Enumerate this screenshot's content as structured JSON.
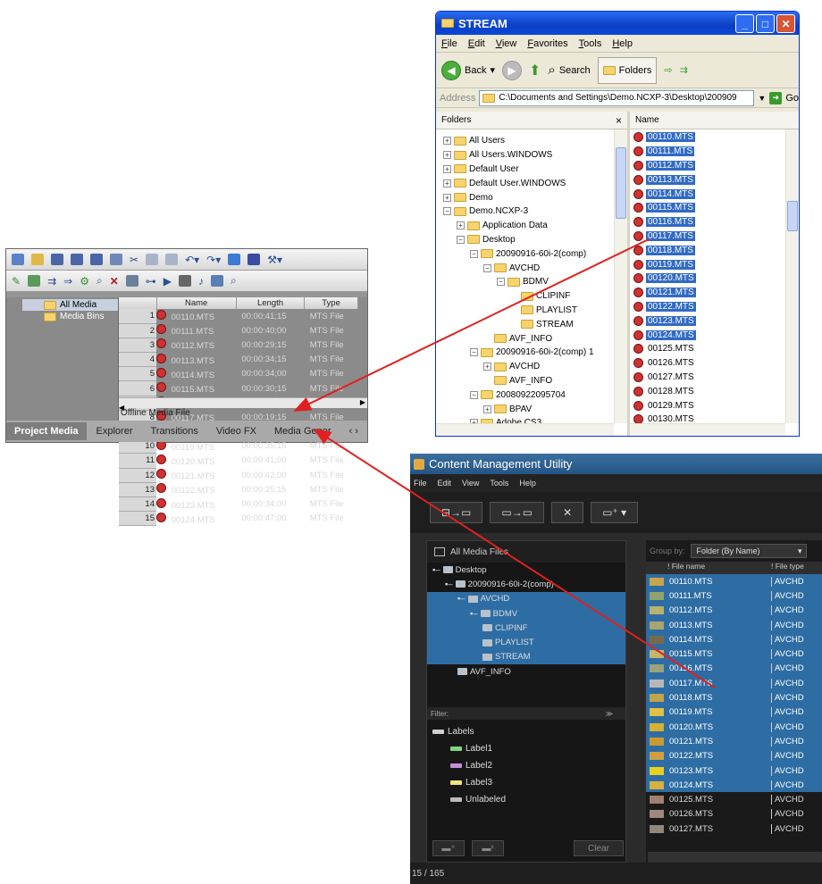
{
  "explorer": {
    "title": "STREAM",
    "menu": [
      "File",
      "Edit",
      "View",
      "Favorites",
      "Tools",
      "Help"
    ],
    "toolbar": {
      "back": "Back",
      "search": "Search",
      "folders": "Folders"
    },
    "address_label": "Address",
    "address_value": "C:\\Documents and Settings\\Demo.NCXP-3\\Desktop\\200909",
    "go": "Go",
    "folders_header": "Folders",
    "close_x": "×",
    "name_header": "Name",
    "tree": [
      {
        "label": "All Users",
        "indent": 0,
        "pm": "+"
      },
      {
        "label": "All Users.WINDOWS",
        "indent": 0,
        "pm": "+"
      },
      {
        "label": "Default User",
        "indent": 0,
        "pm": "+"
      },
      {
        "label": "Default User.WINDOWS",
        "indent": 0,
        "pm": "+"
      },
      {
        "label": "Demo",
        "indent": 0,
        "pm": "+"
      },
      {
        "label": "Demo.NCXP-3",
        "indent": 0,
        "pm": "-"
      },
      {
        "label": "Application Data",
        "indent": 1,
        "pm": "+"
      },
      {
        "label": "Desktop",
        "indent": 1,
        "pm": "-"
      },
      {
        "label": "20090916-60i-2(comp)",
        "indent": 2,
        "pm": "-"
      },
      {
        "label": "AVCHD",
        "indent": 3,
        "pm": "-"
      },
      {
        "label": "BDMV",
        "indent": 4,
        "pm": "-"
      },
      {
        "label": "CLIPINF",
        "indent": 5,
        "pm": ""
      },
      {
        "label": "PLAYLIST",
        "indent": 5,
        "pm": ""
      },
      {
        "label": "STREAM",
        "indent": 5,
        "pm": "",
        "sel": true
      },
      {
        "label": "AVF_INFO",
        "indent": 3,
        "pm": ""
      },
      {
        "label": "20090916-60i-2(comp) 1",
        "indent": 2,
        "pm": "-"
      },
      {
        "label": "AVCHD",
        "indent": 3,
        "pm": "+"
      },
      {
        "label": "AVF_INFO",
        "indent": 3,
        "pm": ""
      },
      {
        "label": "20080922095704",
        "indent": 2,
        "pm": "-"
      },
      {
        "label": "BPAV",
        "indent": 3,
        "pm": "+"
      },
      {
        "label": "Adobe CS3",
        "indent": 2,
        "pm": "+"
      }
    ],
    "files": [
      "00110.MTS",
      "00111.MTS",
      "00112.MTS",
      "00113.MTS",
      "00114.MTS",
      "00115.MTS",
      "00116.MTS",
      "00117.MTS",
      "00118.MTS",
      "00119.MTS",
      "00120.MTS",
      "00121.MTS",
      "00122.MTS",
      "00123.MTS",
      "00124.MTS",
      "00125.MTS",
      "00126.MTS",
      "00127.MTS",
      "00128.MTS",
      "00129.MTS",
      "00130.MTS"
    ],
    "selected_count": 15
  },
  "vegas": {
    "tree": [
      "All Media",
      "Media Bins"
    ],
    "columns": [
      "Name",
      "Length",
      "Type"
    ],
    "rows": [
      [
        "1",
        "00110.MTS",
        "00:00:41;15",
        "MTS File"
      ],
      [
        "2",
        "00111.MTS",
        "00:00:40;00",
        "MTS File"
      ],
      [
        "3",
        "00112.MTS",
        "00:00:29;15",
        "MTS File"
      ],
      [
        "4",
        "00113.MTS",
        "00:00:34;15",
        "MTS File"
      ],
      [
        "5",
        "00114.MTS",
        "00:00:34;00",
        "MTS File"
      ],
      [
        "6",
        "00115.MTS",
        "00:00:30;15",
        "MTS File"
      ],
      [
        "7",
        "00116.MTS",
        "00:00:22;15",
        "MTS File"
      ],
      [
        "8",
        "00117.MTS",
        "00:00:19;15",
        "MTS File"
      ],
      [
        "9",
        "00118.MTS",
        "00:00:31;00",
        "MTS File"
      ],
      [
        "10",
        "00119.MTS",
        "00:00:35;15",
        "MTS File"
      ],
      [
        "11",
        "00120.MTS",
        "00:00:41;00",
        "MTS File"
      ],
      [
        "12",
        "00121.MTS",
        "00:00:42;00",
        "MTS File"
      ],
      [
        "13",
        "00122.MTS",
        "00:00:25;15",
        "MTS File"
      ],
      [
        "14",
        "00123.MTS",
        "00:00:34;00",
        "MTS File"
      ],
      [
        "15",
        "00124.MTS",
        "00:00:47;00",
        "MTS File"
      ]
    ],
    "offline": "Offline Media File",
    "tabs": [
      "Project Media",
      "Explorer",
      "Transitions",
      "Video FX",
      "Media Gener"
    ]
  },
  "cmu": {
    "title": "Content Management Utility",
    "menu": [
      "File",
      "Edit",
      "View",
      "Tools",
      "Help"
    ],
    "all_media": "All Media Files",
    "tree": [
      {
        "label": "Desktop",
        "indent": 0,
        "pm": "-",
        "sel": false
      },
      {
        "label": "20090916-60i-2(comp)",
        "indent": 1,
        "pm": "-",
        "sel": false
      },
      {
        "label": "AVCHD",
        "indent": 2,
        "pm": "-",
        "sel": true
      },
      {
        "label": "BDMV",
        "indent": 3,
        "pm": "-",
        "sel": true
      },
      {
        "label": "CLIPINF",
        "indent": 4,
        "pm": "",
        "sel": true
      },
      {
        "label": "PLAYLIST",
        "indent": 4,
        "pm": "",
        "sel": true
      },
      {
        "label": "STREAM",
        "indent": 4,
        "pm": "",
        "sel": true
      },
      {
        "label": "AVF_INFO",
        "indent": 2,
        "pm": "",
        "sel": false
      }
    ],
    "filter": "Filter:",
    "labels": [
      {
        "label": "Labels",
        "color": "#cfcfcf"
      },
      {
        "label": "Label1",
        "color": "#7fd67f"
      },
      {
        "label": "Label2",
        "color": "#c38fd6"
      },
      {
        "label": "Label3",
        "color": "#f2e37a"
      },
      {
        "label": "Unlabeled",
        "color": "#bbbbbb"
      }
    ],
    "clear": "Clear",
    "group_by": "Group by:",
    "group_value": "Folder (By Name)",
    "col_name": "! File name",
    "col_type": "! File type",
    "files": [
      "00110.MTS",
      "00111.MTS",
      "00112.MTS",
      "00113.MTS",
      "00114.MTS",
      "00115.MTS",
      "00116.MTS",
      "00117.MTS",
      "00118.MTS",
      "00119.MTS",
      "00120.MTS",
      "00121.MTS",
      "00122.MTS",
      "00123.MTS",
      "00124.MTS",
      "00125.MTS",
      "00126.MTS",
      "00127.MTS"
    ],
    "file_type": "AVCHD",
    "selected_count": 15,
    "status": "15 / 165"
  },
  "colors": {
    "arrow": "#e02020",
    "xp_select": "#316ac5",
    "cmu_select": "#2e6da4"
  }
}
